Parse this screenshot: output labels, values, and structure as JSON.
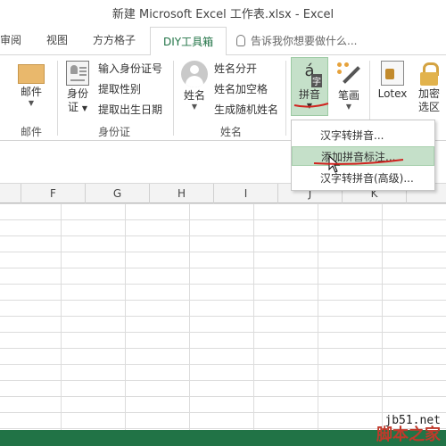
{
  "window": {
    "title": "新建 Microsoft Excel 工作表.xlsx - Excel"
  },
  "tabs": [
    "审阅",
    "视图",
    "方方格子",
    "DIY工具箱"
  ],
  "tell_me": "告诉我你想要做什么...",
  "ribbon": {
    "mail_group": {
      "button": "邮件",
      "label": "邮件"
    },
    "id_group": {
      "button_line1": "身份",
      "button_line2": "证",
      "items": [
        "输入身份证号",
        "提取性别",
        "提取出生日期"
      ],
      "label": "身份证"
    },
    "name_group": {
      "button": "姓名",
      "items": [
        "姓名分开",
        "姓名加空格",
        "生成随机姓名"
      ],
      "label": "姓名"
    },
    "pinyin": {
      "label": "拼音"
    },
    "pen": {
      "label": "笔画"
    },
    "lotex": {
      "label": "Lotex"
    },
    "encrypt": {
      "line1": "加密",
      "line2": "选区"
    }
  },
  "dropdown": {
    "items": [
      "汉字转拼音...",
      "添加拼音标注...",
      "汉字转拼音(高级)..."
    ],
    "highlighted_index": 1
  },
  "columns": [
    "F",
    "G",
    "H",
    "I",
    "J",
    "K"
  ],
  "watermark": {
    "url": "jb51.net",
    "text": "脚本之家"
  }
}
